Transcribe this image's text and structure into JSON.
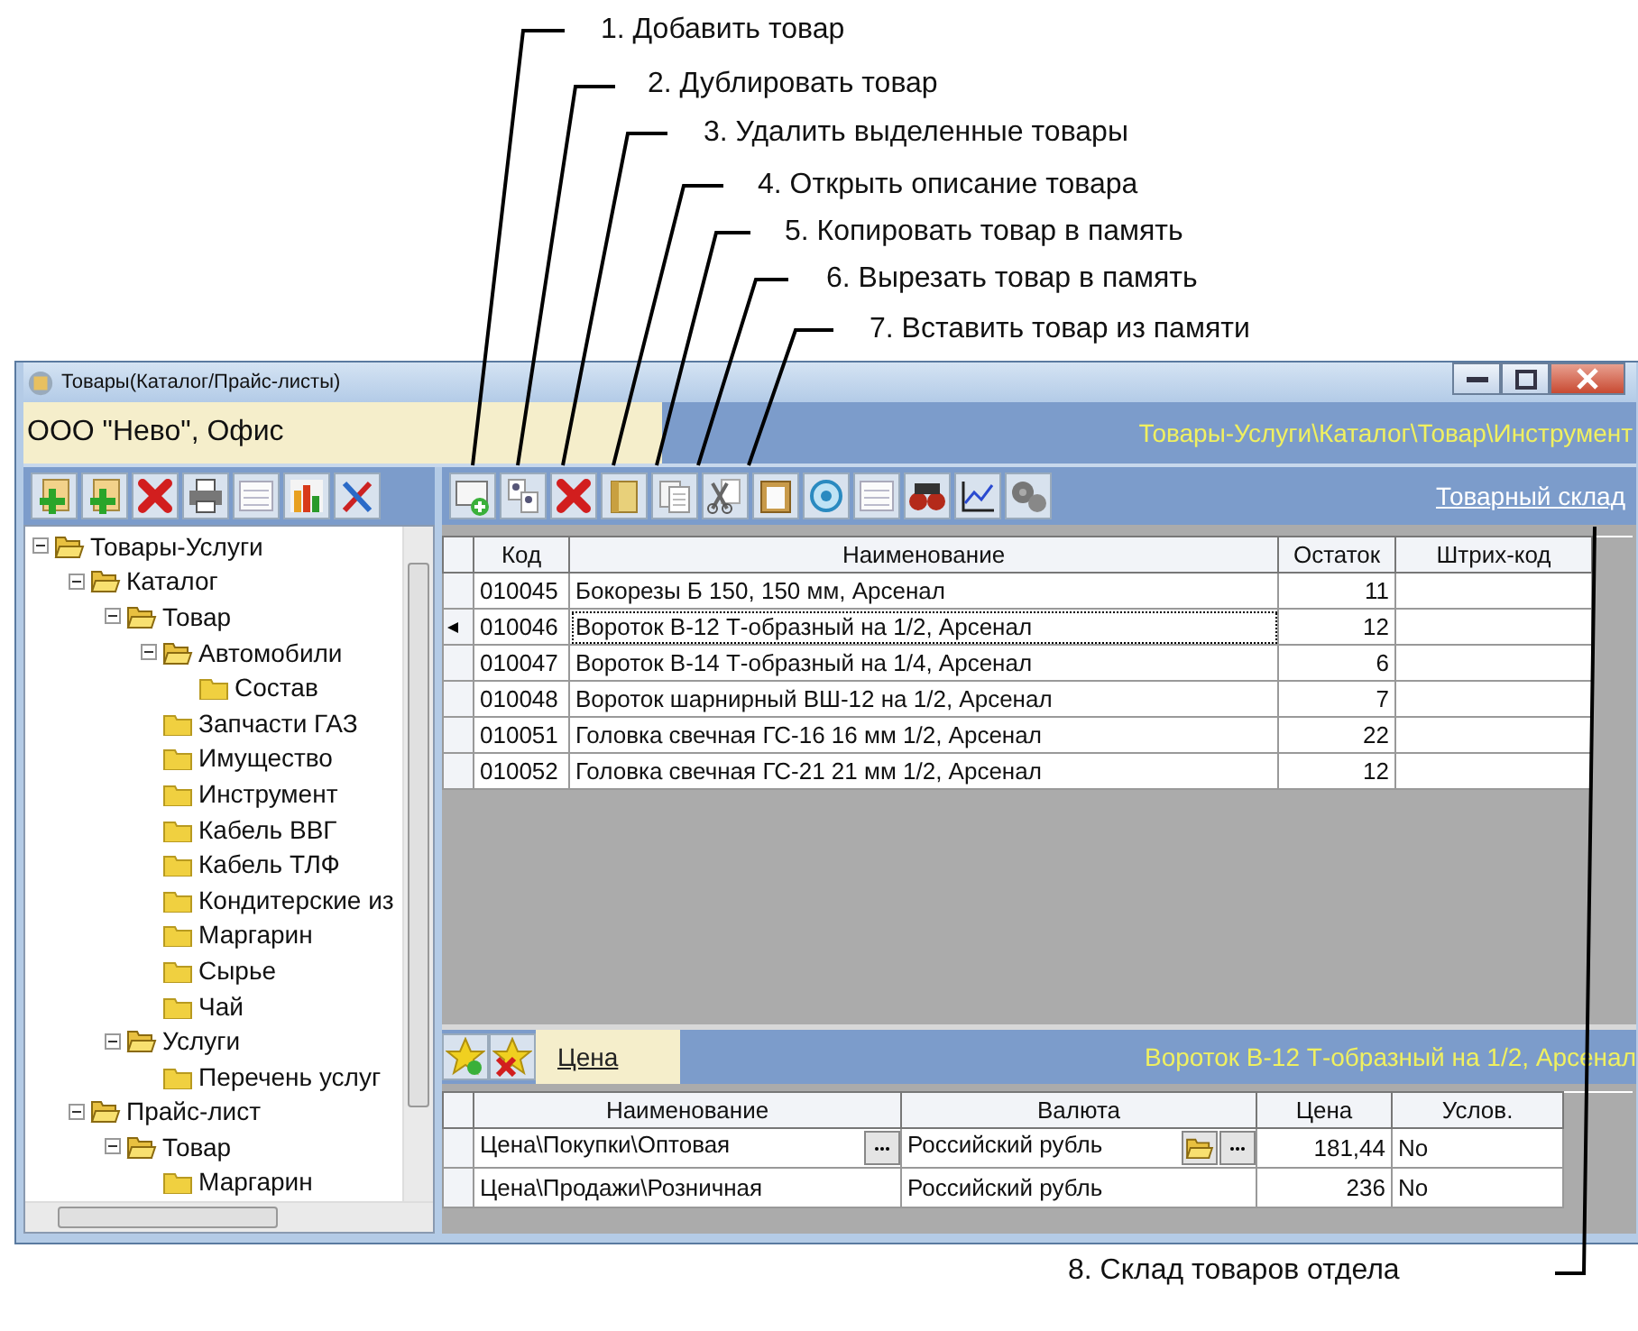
{
  "annotations": [
    "1. Добавить товар",
    "2. Дублировать товар",
    "3. Удалить выделенные товары",
    "4. Открыть описание товара",
    "5. Копировать товар в память",
    "6. Вырезать товар в память",
    "7. Вставить товар из памяти",
    "8. Склад товаров отдела"
  ],
  "window": {
    "title": "Товары(Каталог/Прайс-листы)",
    "organization": "ООО \"Нево\", Офис",
    "path": "Товары-Услуги\\Каталог\\Товар\\Инструмент"
  },
  "toolbar": {
    "link": "Товарный склад"
  },
  "tree": [
    {
      "label": "Товары-Услуги",
      "expanded": true,
      "children": [
        {
          "label": "Каталог",
          "expanded": true,
          "children": [
            {
              "label": "Товар",
              "expanded": true,
              "children": [
                {
                  "label": "Автомобили",
                  "expanded": true,
                  "children": [
                    {
                      "label": "Состав"
                    }
                  ]
                },
                {
                  "label": "Запчасти ГАЗ"
                },
                {
                  "label": "Имущество"
                },
                {
                  "label": "Инструмент"
                },
                {
                  "label": "Кабель ВВГ"
                },
                {
                  "label": "Кабель ТЛФ"
                },
                {
                  "label": "Кондитерские из"
                },
                {
                  "label": "Маргарин"
                },
                {
                  "label": "Сырье"
                },
                {
                  "label": "Чай"
                }
              ]
            },
            {
              "label": "Услуги",
              "expanded": true,
              "children": [
                {
                  "label": "Перечень услуг"
                }
              ]
            }
          ]
        },
        {
          "label": "Прайс-лист",
          "expanded": true,
          "children": [
            {
              "label": "Товар",
              "expanded": true,
              "children": [
                {
                  "label": "Маргарин"
                }
              ]
            }
          ]
        }
      ]
    }
  ],
  "products": {
    "columns": [
      "Код",
      "Наименование",
      "Остаток",
      "Штрих-код"
    ],
    "rows": [
      {
        "code": "010045",
        "name": "Бокорезы Б 150, 150 мм, Арсенал",
        "stock": "11",
        "selected": false
      },
      {
        "code": "010046",
        "name": "Вороток В-12 Т-образный на 1/2, Арсенал",
        "stock": "12",
        "selected": true
      },
      {
        "code": "010047",
        "name": "Вороток В-14 Т-образный на 1/4, Арсенал",
        "stock": "6",
        "selected": false
      },
      {
        "code": "010048",
        "name": "Вороток шарнирный ВШ-12 на 1/2, Арсенал",
        "stock": "7",
        "selected": false
      },
      {
        "code": "010051",
        "name": "Головка свечная ГС-16 16 мм 1/2, Арсенал",
        "stock": "22",
        "selected": false
      },
      {
        "code": "010052",
        "name": "Головка свечная ГС-21 21 мм 1/2, Арсенал",
        "stock": "12",
        "selected": false
      }
    ]
  },
  "details": {
    "tabs": [
      {
        "label": "Цена",
        "selected": true
      }
    ],
    "caption": "Вороток В-12 Т-образный на 1/2, Арсенал",
    "columns": [
      "Наименование",
      "Валюта",
      "Цена",
      "Услов."
    ],
    "rows": [
      {
        "name": "Цена\\Покупки\\Оптовая",
        "currency": "Российский рубль",
        "price": "181,44",
        "condition": "No",
        "selected": true
      },
      {
        "name": "Цена\\Продажи\\Розничная",
        "currency": "Российский рубль",
        "price": "236",
        "condition": "No",
        "selected": false
      }
    ]
  }
}
